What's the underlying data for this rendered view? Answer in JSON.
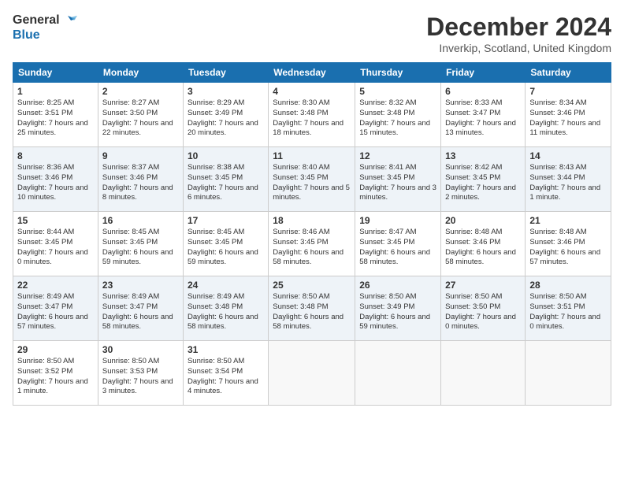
{
  "header": {
    "logo_line1": "General",
    "logo_line2": "Blue",
    "month_title": "December 2024",
    "location": "Inverkip, Scotland, United Kingdom"
  },
  "days_of_week": [
    "Sunday",
    "Monday",
    "Tuesday",
    "Wednesday",
    "Thursday",
    "Friday",
    "Saturday"
  ],
  "weeks": [
    [
      {
        "day": "1",
        "sunrise": "8:25 AM",
        "sunset": "3:51 PM",
        "daylight": "7 hours and 25 minutes."
      },
      {
        "day": "2",
        "sunrise": "8:27 AM",
        "sunset": "3:50 PM",
        "daylight": "7 hours and 22 minutes."
      },
      {
        "day": "3",
        "sunrise": "8:29 AM",
        "sunset": "3:49 PM",
        "daylight": "7 hours and 20 minutes."
      },
      {
        "day": "4",
        "sunrise": "8:30 AM",
        "sunset": "3:48 PM",
        "daylight": "7 hours and 18 minutes."
      },
      {
        "day": "5",
        "sunrise": "8:32 AM",
        "sunset": "3:48 PM",
        "daylight": "7 hours and 15 minutes."
      },
      {
        "day": "6",
        "sunrise": "8:33 AM",
        "sunset": "3:47 PM",
        "daylight": "7 hours and 13 minutes."
      },
      {
        "day": "7",
        "sunrise": "8:34 AM",
        "sunset": "3:46 PM",
        "daylight": "7 hours and 11 minutes."
      }
    ],
    [
      {
        "day": "8",
        "sunrise": "8:36 AM",
        "sunset": "3:46 PM",
        "daylight": "7 hours and 10 minutes."
      },
      {
        "day": "9",
        "sunrise": "8:37 AM",
        "sunset": "3:46 PM",
        "daylight": "7 hours and 8 minutes."
      },
      {
        "day": "10",
        "sunrise": "8:38 AM",
        "sunset": "3:45 PM",
        "daylight": "7 hours and 6 minutes."
      },
      {
        "day": "11",
        "sunrise": "8:40 AM",
        "sunset": "3:45 PM",
        "daylight": "7 hours and 5 minutes."
      },
      {
        "day": "12",
        "sunrise": "8:41 AM",
        "sunset": "3:45 PM",
        "daylight": "7 hours and 3 minutes."
      },
      {
        "day": "13",
        "sunrise": "8:42 AM",
        "sunset": "3:45 PM",
        "daylight": "7 hours and 2 minutes."
      },
      {
        "day": "14",
        "sunrise": "8:43 AM",
        "sunset": "3:44 PM",
        "daylight": "7 hours and 1 minute."
      }
    ],
    [
      {
        "day": "15",
        "sunrise": "8:44 AM",
        "sunset": "3:45 PM",
        "daylight": "7 hours and 0 minutes."
      },
      {
        "day": "16",
        "sunrise": "8:45 AM",
        "sunset": "3:45 PM",
        "daylight": "6 hours and 59 minutes."
      },
      {
        "day": "17",
        "sunrise": "8:45 AM",
        "sunset": "3:45 PM",
        "daylight": "6 hours and 59 minutes."
      },
      {
        "day": "18",
        "sunrise": "8:46 AM",
        "sunset": "3:45 PM",
        "daylight": "6 hours and 58 minutes."
      },
      {
        "day": "19",
        "sunrise": "8:47 AM",
        "sunset": "3:45 PM",
        "daylight": "6 hours and 58 minutes."
      },
      {
        "day": "20",
        "sunrise": "8:48 AM",
        "sunset": "3:46 PM",
        "daylight": "6 hours and 58 minutes."
      },
      {
        "day": "21",
        "sunrise": "8:48 AM",
        "sunset": "3:46 PM",
        "daylight": "6 hours and 57 minutes."
      }
    ],
    [
      {
        "day": "22",
        "sunrise": "8:49 AM",
        "sunset": "3:47 PM",
        "daylight": "6 hours and 57 minutes."
      },
      {
        "day": "23",
        "sunrise": "8:49 AM",
        "sunset": "3:47 PM",
        "daylight": "6 hours and 58 minutes."
      },
      {
        "day": "24",
        "sunrise": "8:49 AM",
        "sunset": "3:48 PM",
        "daylight": "6 hours and 58 minutes."
      },
      {
        "day": "25",
        "sunrise": "8:50 AM",
        "sunset": "3:48 PM",
        "daylight": "6 hours and 58 minutes."
      },
      {
        "day": "26",
        "sunrise": "8:50 AM",
        "sunset": "3:49 PM",
        "daylight": "6 hours and 59 minutes."
      },
      {
        "day": "27",
        "sunrise": "8:50 AM",
        "sunset": "3:50 PM",
        "daylight": "7 hours and 0 minutes."
      },
      {
        "day": "28",
        "sunrise": "8:50 AM",
        "sunset": "3:51 PM",
        "daylight": "7 hours and 0 minutes."
      }
    ],
    [
      {
        "day": "29",
        "sunrise": "8:50 AM",
        "sunset": "3:52 PM",
        "daylight": "7 hours and 1 minute."
      },
      {
        "day": "30",
        "sunrise": "8:50 AM",
        "sunset": "3:53 PM",
        "daylight": "7 hours and 3 minutes."
      },
      {
        "day": "31",
        "sunrise": "8:50 AM",
        "sunset": "3:54 PM",
        "daylight": "7 hours and 4 minutes."
      },
      null,
      null,
      null,
      null
    ]
  ]
}
